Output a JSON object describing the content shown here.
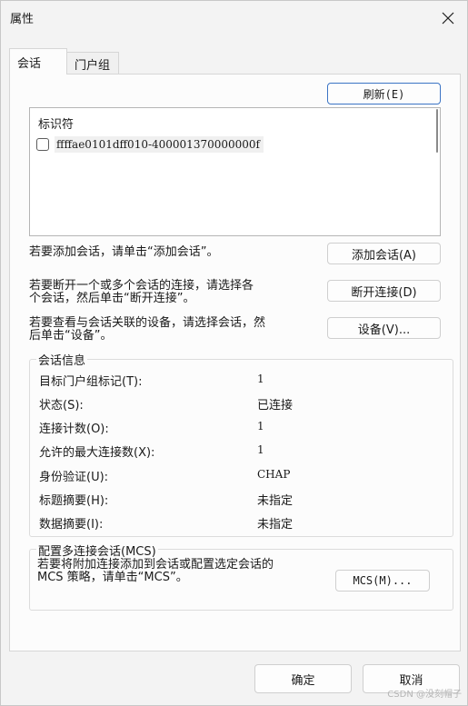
{
  "window": {
    "title": "属性"
  },
  "tabs": [
    {
      "label": "会话",
      "active": true
    },
    {
      "label": "门户组",
      "active": false
    }
  ],
  "buttons": {
    "refresh": "刷新(E)",
    "add_session": "添加会话(A)",
    "disconnect": "断开连接(D)",
    "devices": "设备(V)...",
    "mcs": "MCS(M)...",
    "ok": "确定",
    "cancel": "取消"
  },
  "session_list": {
    "header": "标识符",
    "items": [
      {
        "id": "ffffae0101dff010-400001370000000f",
        "checked": false
      }
    ]
  },
  "instructions": {
    "add": "若要添加会话，请单击“添加会话”。",
    "disconnect_line1": "若要断开一个或多个会话的连接，请选择各",
    "disconnect_line2": "个会话，然后单击“断开连接”。",
    "devices_line1": "若要查看与会话关联的设备，请选择会话，然",
    "devices_line2": "后单击“设备”。"
  },
  "session_info": {
    "legend": "会话信息",
    "rows": [
      {
        "label": "目标门户组标记(T):",
        "value": "1"
      },
      {
        "label": "状态(S):",
        "value": "已连接"
      },
      {
        "label": "连接计数(O):",
        "value": "1"
      },
      {
        "label": "允许的最大连接数(X):",
        "value": "1"
      },
      {
        "label": "身份验证(U):",
        "value": "CHAP"
      },
      {
        "label": "标题摘要(H):",
        "value": "未指定"
      },
      {
        "label": "数据摘要(I):",
        "value": "未指定"
      }
    ]
  },
  "mcs_group": {
    "legend": "配置多连接会话(MCS)",
    "text_line1": "若要将附加连接添加到会话或配置选定会话的",
    "text_line2": "MCS 策略，请单击“MCS”。"
  },
  "watermark": "CSDN @没刻帽子",
  "colors": {
    "accent": "#3a73c4",
    "background": "#f3f3f3",
    "panel": "#fcfcfc"
  }
}
